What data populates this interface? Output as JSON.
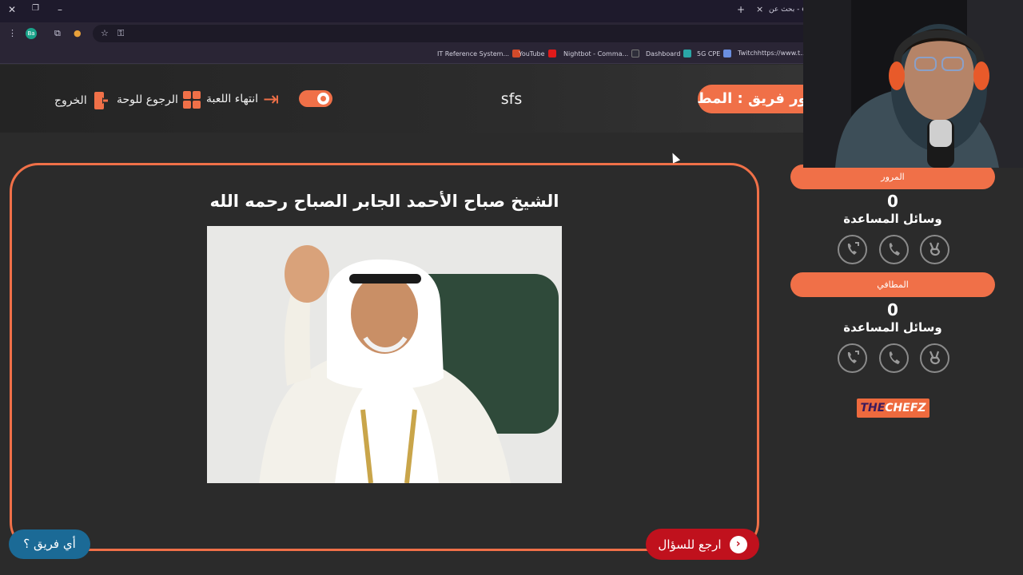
{
  "browser": {
    "active_tab": "بحث عن - e",
    "new_tab_glyph": "+",
    "close_glyph": "×",
    "profile_initials": "Ba",
    "bookmarks": [
      {
        "label": "IT Reference System...",
        "color": "#d14a2a"
      },
      {
        "label": "YouTube",
        "color": "#e01a1a"
      },
      {
        "label": "Nightbot - Comma...",
        "color": "#2e2e3a"
      },
      {
        "label": "Dashboard",
        "color": "#2aa6a6"
      },
      {
        "label": "5G CPE",
        "color": "#6a8fe0"
      },
      {
        "label": "Twitchhttps://www.t...",
        "color": "#9146ff"
      }
    ]
  },
  "header": {
    "exit_label": "الخروج",
    "board_label": "الرجوع للوحة",
    "end_label": "انتهاء اللعبة",
    "game_title": "sfs",
    "turn_text": "دور فريق : المطافي"
  },
  "question": {
    "answer_text": "الشيخ صباح الأحمد الجابر الصباح رحمه الله",
    "back_label": "ارجع للسؤال",
    "back_icon": "chevron-left-icon",
    "which_team_label": "أي فريق ؟"
  },
  "teams": [
    {
      "name": "المرور",
      "score": "0",
      "helps_label": "وسائل المساعدة"
    },
    {
      "name": "المطافي",
      "score": "0",
      "helps_label": "وسائل المساعدة"
    }
  ],
  "logo": {
    "part1": "THE",
    "part2": "CHEFZ"
  },
  "colors": {
    "accent": "#f07048",
    "back_button": "#c0111d",
    "which_button": "#1b6a96",
    "background": "#2b2b2b"
  }
}
